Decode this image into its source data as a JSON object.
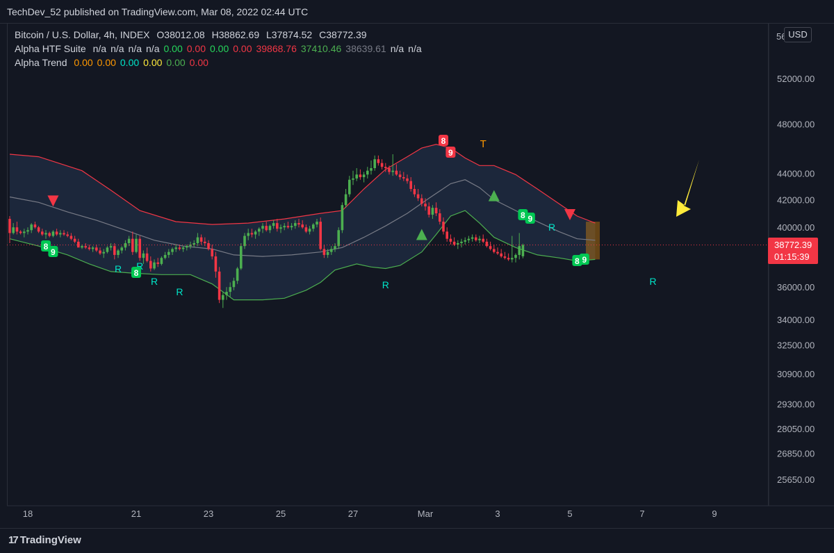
{
  "header": {
    "published": "TechDev_52 published on TradingView.com, Mar 08, 2022 02:44 UTC"
  },
  "legend": {
    "symbol": {
      "name": "Bitcoin / U.S. Dollar, 4h, INDEX",
      "open": "O38012.08",
      "high": "H38862.69",
      "low": "L37874.52",
      "close": "C38772.39"
    },
    "htf_suite": {
      "name": "Alpha HTF Suite",
      "values": [
        {
          "text": "n/a",
          "color": "#d1d4dc"
        },
        {
          "text": "n/a",
          "color": "#d1d4dc"
        },
        {
          "text": "n/a",
          "color": "#d1d4dc"
        },
        {
          "text": "n/a",
          "color": "#d1d4dc"
        },
        {
          "text": "0.00",
          "color": "#26d65b"
        },
        {
          "text": "0.00",
          "color": "#f23645"
        },
        {
          "text": "0.00",
          "color": "#26d65b"
        },
        {
          "text": "0.00",
          "color": "#f23645"
        },
        {
          "text": "39868.76",
          "color": "#f23645"
        },
        {
          "text": "37410.46",
          "color": "#4caf50"
        },
        {
          "text": "38639.61",
          "color": "#787b86"
        },
        {
          "text": "n/a",
          "color": "#d1d4dc"
        },
        {
          "text": "n/a",
          "color": "#d1d4dc"
        }
      ]
    },
    "trend": {
      "name": "Alpha Trend",
      "values": [
        {
          "text": "0.00",
          "color": "#ff9800"
        },
        {
          "text": "0.00",
          "color": "#ff9800"
        },
        {
          "text": "0.00",
          "color": "#00e5c8"
        },
        {
          "text": "0.00",
          "color": "#ffeb3b"
        },
        {
          "text": "0.00",
          "color": "#4caf50"
        },
        {
          "text": "0.00",
          "color": "#f23645"
        }
      ]
    }
  },
  "price_axis": {
    "currency": "USD",
    "current_price": "38772.39",
    "countdown": "01:15:39",
    "top_label": "56"
  },
  "footer": {
    "brand": "TradingView"
  },
  "colors": {
    "background": "#131722",
    "up": "#4caf50",
    "down": "#f23645",
    "upper_band": "#f23645",
    "lower_band": "#4caf50",
    "mid_band": "#787b86",
    "band_fill": "#1e2a40",
    "marker_green": "#00c853",
    "r_label": "#00e5c8",
    "arrow": "#ffeb3b",
    "t_label": "#ff9800"
  },
  "chart_data": {
    "type": "candlestick",
    "title": "Bitcoin / U.S. Dollar, 4h, INDEX",
    "y_scale": "log",
    "ylim": [
      24800,
      58500
    ],
    "y_ticks": [
      "52000.00",
      "48000.00",
      "44000.00",
      "42000.00",
      "40000.00",
      "36000.00",
      "34000.00",
      "32500.00",
      "30900.00",
      "29300.00",
      "28050.00",
      "26850.00",
      "25650.00"
    ],
    "x_ticks": [
      "18",
      "21",
      "23",
      "25",
      "27",
      "Mar",
      "3",
      "5",
      "7",
      "9"
    ],
    "x_tick_index": [
      5,
      35,
      55,
      75,
      95,
      115,
      135,
      155,
      175,
      195
    ],
    "candles": [
      [
        40600,
        40800,
        38900,
        39600
      ],
      [
        39600,
        40300,
        39500,
        40000
      ],
      [
        40000,
        40400,
        39500,
        39700
      ],
      [
        39700,
        39800,
        39500,
        39600
      ],
      [
        39600,
        39900,
        39300,
        39700
      ],
      [
        39700,
        40000,
        39500,
        39800
      ],
      [
        39800,
        40300,
        39600,
        40200
      ],
      [
        40200,
        40400,
        39900,
        40000
      ],
      [
        40000,
        40100,
        39600,
        39700
      ],
      [
        39700,
        39900,
        39400,
        39500
      ],
      [
        39500,
        39800,
        39200,
        39600
      ],
      [
        39600,
        39700,
        39300,
        39400
      ],
      [
        39400,
        39800,
        39300,
        39700
      ],
      [
        39700,
        39900,
        39400,
        39500
      ],
      [
        39500,
        39800,
        39300,
        39600
      ],
      [
        39600,
        39800,
        39400,
        39500
      ],
      [
        39500,
        39700,
        39300,
        39400
      ],
      [
        39400,
        39600,
        39100,
        39200
      ],
      [
        39200,
        39400,
        38900,
        39000
      ],
      [
        39000,
        39200,
        38800,
        38600
      ],
      [
        38600,
        38800,
        38500,
        38700
      ],
      [
        38700,
        38900,
        38500,
        38600
      ],
      [
        38600,
        38800,
        38400,
        38500
      ],
      [
        38500,
        38700,
        38300,
        38600
      ],
      [
        38600,
        38800,
        38300,
        38400
      ],
      [
        38400,
        38600,
        38100,
        38200
      ],
      [
        38200,
        38500,
        37900,
        38300
      ],
      [
        38300,
        38700,
        38200,
        38600
      ],
      [
        38600,
        38900,
        38400,
        38700
      ],
      [
        38700,
        38900,
        37800,
        38100
      ],
      [
        38100,
        38500,
        37900,
        38400
      ],
      [
        38400,
        38700,
        38200,
        38600
      ],
      [
        38600,
        39100,
        38400,
        38900
      ],
      [
        38900,
        39400,
        38700,
        39200
      ],
      [
        39200,
        39700,
        38100,
        38300
      ],
      [
        38300,
        39500,
        38200,
        39200
      ],
      [
        39200,
        39400,
        37700,
        37900
      ],
      [
        37900,
        38400,
        37500,
        38200
      ],
      [
        38200,
        38600,
        37600,
        37700
      ],
      [
        37700,
        38000,
        37000,
        37200
      ],
      [
        37200,
        37800,
        37100,
        37600
      ],
      [
        37600,
        37900,
        37300,
        37500
      ],
      [
        37500,
        38000,
        37400,
        37900
      ],
      [
        37900,
        38300,
        37800,
        38100
      ],
      [
        38100,
        38500,
        37900,
        38300
      ],
      [
        38300,
        38600,
        38100,
        38500
      ],
      [
        38500,
        38800,
        38300,
        38600
      ],
      [
        38600,
        38800,
        38400,
        38500
      ],
      [
        38500,
        38700,
        38300,
        38600
      ],
      [
        38600,
        38800,
        38400,
        38700
      ],
      [
        38700,
        39000,
        38500,
        38800
      ],
      [
        38800,
        39100,
        38600,
        38900
      ],
      [
        38900,
        39600,
        38700,
        39300
      ],
      [
        39300,
        39500,
        38800,
        39000
      ],
      [
        39000,
        39300,
        38700,
        38900
      ],
      [
        38900,
        39100,
        38400,
        38500
      ],
      [
        38500,
        38800,
        37800,
        38000
      ],
      [
        38000,
        38300,
        36600,
        37000
      ],
      [
        37000,
        37300,
        35000,
        35200
      ],
      [
        35200,
        35700,
        34700,
        35500
      ],
      [
        35500,
        36000,
        35200,
        35700
      ],
      [
        35700,
        36300,
        35400,
        36000
      ],
      [
        36000,
        36600,
        35800,
        36400
      ],
      [
        36400,
        37300,
        36200,
        37200
      ],
      [
        37200,
        38900,
        37100,
        38700
      ],
      [
        38700,
        39600,
        38500,
        39400
      ],
      [
        39400,
        39900,
        39100,
        39600
      ],
      [
        39600,
        39900,
        39300,
        39500
      ],
      [
        39500,
        39800,
        39200,
        39700
      ],
      [
        39700,
        40000,
        39400,
        39900
      ],
      [
        39900,
        40300,
        39600,
        40100
      ],
      [
        40100,
        40400,
        39700,
        39800
      ],
      [
        39800,
        40200,
        39600,
        40100
      ],
      [
        40100,
        40500,
        39900,
        40300
      ],
      [
        40300,
        40600,
        39700,
        39900
      ],
      [
        39900,
        40200,
        39600,
        40000
      ],
      [
        40000,
        40300,
        39800,
        40100
      ],
      [
        40100,
        40400,
        39900,
        40000
      ],
      [
        40000,
        40300,
        39800,
        40100
      ],
      [
        40100,
        40500,
        39900,
        40300
      ],
      [
        40300,
        40600,
        40000,
        40200
      ],
      [
        40200,
        40500,
        39900,
        40000
      ],
      [
        40000,
        40200,
        39600,
        39700
      ],
      [
        39700,
        40100,
        39500,
        39900
      ],
      [
        39900,
        40300,
        39700,
        40200
      ],
      [
        40200,
        40600,
        40000,
        40400
      ],
      [
        40400,
        40700,
        38400,
        38500
      ],
      [
        38500,
        38800,
        37900,
        38100
      ],
      [
        38100,
        38500,
        37900,
        38300
      ],
      [
        38300,
        38700,
        38100,
        38500
      ],
      [
        38500,
        38900,
        38300,
        38700
      ],
      [
        38700,
        40000,
        38500,
        39800
      ],
      [
        39800,
        41800,
        39600,
        41600
      ],
      [
        41600,
        42800,
        41400,
        42400
      ],
      [
        42400,
        43800,
        42200,
        43500
      ],
      [
        43500,
        44200,
        43100,
        43600
      ],
      [
        43600,
        44400,
        43400,
        43900
      ],
      [
        43900,
        44300,
        43500,
        43700
      ],
      [
        43700,
        44100,
        43300,
        43900
      ],
      [
        43900,
        44500,
        43600,
        44200
      ],
      [
        44200,
        45000,
        43900,
        44400
      ],
      [
        44400,
        45400,
        44200,
        45100
      ],
      [
        45100,
        45400,
        44600,
        44800
      ],
      [
        44800,
        45100,
        44300,
        44500
      ],
      [
        44500,
        44800,
        44100,
        44400
      ],
      [
        44400,
        44600,
        43900,
        44100
      ],
      [
        44100,
        45500,
        43800,
        44200
      ],
      [
        44200,
        44700,
        43800,
        43900
      ],
      [
        43900,
        44200,
        43500,
        43700
      ],
      [
        43700,
        44100,
        43400,
        43600
      ],
      [
        43600,
        43900,
        43200,
        43400
      ],
      [
        43400,
        43700,
        42600,
        42800
      ],
      [
        42800,
        43100,
        42200,
        42400
      ],
      [
        42400,
        42800,
        41900,
        42100
      ],
      [
        42100,
        42400,
        41500,
        41700
      ],
      [
        41700,
        42100,
        41200,
        41500
      ],
      [
        41500,
        41800,
        40700,
        40900
      ],
      [
        40900,
        41600,
        40600,
        41400
      ],
      [
        41400,
        41800,
        40800,
        41000
      ],
      [
        41000,
        41300,
        40200,
        40400
      ],
      [
        40400,
        40700,
        39500,
        39700
      ],
      [
        39700,
        40000,
        39000,
        39200
      ],
      [
        39200,
        39500,
        38800,
        39000
      ],
      [
        39000,
        39300,
        38700,
        38800
      ],
      [
        38800,
        39100,
        38500,
        38900
      ],
      [
        38900,
        39200,
        38600,
        39000
      ],
      [
        39000,
        39300,
        38800,
        39100
      ],
      [
        39100,
        39400,
        38900,
        39200
      ],
      [
        39200,
        39500,
        39000,
        39300
      ],
      [
        39300,
        39500,
        39000,
        39100
      ],
      [
        39100,
        39400,
        38900,
        39200
      ],
      [
        39200,
        39500,
        38900,
        39000
      ],
      [
        39000,
        39200,
        38600,
        38700
      ],
      [
        38700,
        39000,
        38400,
        38500
      ],
      [
        38500,
        38800,
        38200,
        38300
      ],
      [
        38300,
        38600,
        38100,
        38200
      ],
      [
        38200,
        38500,
        37900,
        38000
      ],
      [
        38000,
        38300,
        37800,
        37900
      ],
      [
        37900,
        38200,
        37700,
        37800
      ],
      [
        37800,
        39400,
        37600,
        37900
      ],
      [
        37900,
        38200,
        37600,
        38100
      ],
      [
        38100,
        39600,
        37800,
        38700
      ],
      [
        38012.08,
        38862.69,
        37874.52,
        38772.39
      ]
    ],
    "upper_band": [
      [
        0,
        45500
      ],
      [
        8,
        45300
      ],
      [
        20,
        44200
      ],
      [
        28,
        42700
      ],
      [
        36,
        41200
      ],
      [
        46,
        40400
      ],
      [
        56,
        40200
      ],
      [
        66,
        40300
      ],
      [
        76,
        40600
      ],
      [
        86,
        41000
      ],
      [
        92,
        41200
      ],
      [
        98,
        42800
      ],
      [
        104,
        44300
      ],
      [
        110,
        45300
      ],
      [
        114,
        46000
      ],
      [
        118,
        46300
      ],
      [
        122,
        46000
      ],
      [
        126,
        45200
      ],
      [
        130,
        44600
      ],
      [
        134,
        44600
      ],
      [
        140,
        43900
      ],
      [
        146,
        42800
      ],
      [
        152,
        41700
      ],
      [
        157,
        40800
      ],
      [
        162,
        40300
      ]
    ],
    "lower_band": [
      [
        0,
        39200
      ],
      [
        8,
        38700
      ],
      [
        16,
        38100
      ],
      [
        22,
        37500
      ],
      [
        28,
        37000
      ],
      [
        34,
        36900
      ],
      [
        42,
        36800
      ],
      [
        50,
        36800
      ],
      [
        56,
        36200
      ],
      [
        62,
        35200
      ],
      [
        70,
        35200
      ],
      [
        76,
        35300
      ],
      [
        82,
        35800
      ],
      [
        86,
        36300
      ],
      [
        90,
        37100
      ],
      [
        96,
        37500
      ],
      [
        100,
        37300
      ],
      [
        104,
        37200
      ],
      [
        108,
        37400
      ],
      [
        114,
        38300
      ],
      [
        118,
        39500
      ],
      [
        122,
        40800
      ],
      [
        126,
        41200
      ],
      [
        130,
        40300
      ],
      [
        134,
        39300
      ],
      [
        140,
        38600
      ],
      [
        146,
        38100
      ],
      [
        152,
        37900
      ],
      [
        157,
        37700
      ],
      [
        162,
        37800
      ]
    ],
    "mid_band": [
      [
        0,
        42200
      ],
      [
        8,
        41800
      ],
      [
        16,
        41100
      ],
      [
        24,
        40500
      ],
      [
        32,
        39800
      ],
      [
        40,
        39100
      ],
      [
        48,
        38700
      ],
      [
        56,
        38500
      ],
      [
        62,
        38100
      ],
      [
        70,
        38000
      ],
      [
        78,
        38100
      ],
      [
        86,
        38300
      ],
      [
        92,
        38600
      ],
      [
        98,
        39300
      ],
      [
        104,
        40100
      ],
      [
        110,
        41000
      ],
      [
        116,
        42100
      ],
      [
        122,
        43200
      ],
      [
        126,
        43500
      ],
      [
        130,
        42900
      ],
      [
        134,
        42000
      ],
      [
        140,
        41200
      ],
      [
        146,
        40400
      ],
      [
        152,
        39700
      ],
      [
        157,
        39200
      ],
      [
        162,
        39100
      ]
    ],
    "current_price": 38772.39
  }
}
